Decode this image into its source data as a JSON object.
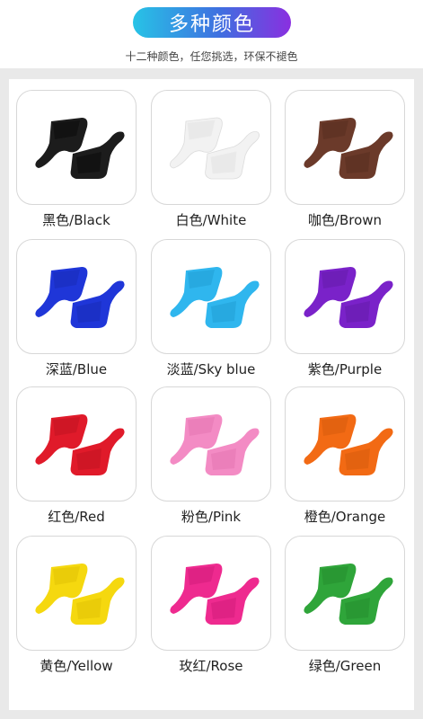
{
  "header": {
    "title": "多种颜色",
    "subtitle": "十二种颜色，任您挑选，环保不褪色"
  },
  "colors": [
    {
      "label": "黑色/Black",
      "hex": "#1c1c1c",
      "shade": "#000000"
    },
    {
      "label": "白色/White",
      "hex": "#f2f2f2",
      "shade": "#d9d9d9"
    },
    {
      "label": "咖色/Brown",
      "hex": "#6b3a2a",
      "shade": "#4e271b"
    },
    {
      "label": "深蓝/Blue",
      "hex": "#1f36d8",
      "shade": "#1425a6"
    },
    {
      "label": "淡蓝/Sky blue",
      "hex": "#2fb6ee",
      "shade": "#1a92c7"
    },
    {
      "label": "紫色/Purple",
      "hex": "#7a22c9",
      "shade": "#5a1699"
    },
    {
      "label": "红色/Red",
      "hex": "#e01a2a",
      "shade": "#b0101d"
    },
    {
      "label": "粉色/Pink",
      "hex": "#f38bc4",
      "shade": "#dc6aa8"
    },
    {
      "label": "橙色/Orange",
      "hex": "#f26a14",
      "shade": "#c9520a"
    },
    {
      "label": "黄色/Yellow",
      "hex": "#f5d80f",
      "shade": "#d7b800"
    },
    {
      "label": "玫红/Rose",
      "hex": "#ee2a8f",
      "shade": "#c41470"
    },
    {
      "label": "绿色/Green",
      "hex": "#2fa53a",
      "shade": "#1f8029"
    }
  ]
}
